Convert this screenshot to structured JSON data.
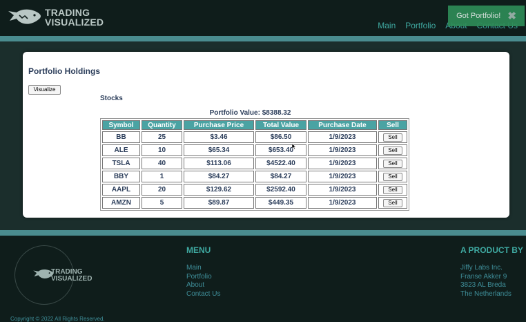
{
  "header": {
    "logo_line1": "TRADING",
    "logo_line2": "VISUALIZED",
    "nav": [
      "Main",
      "Portfolio",
      "About",
      "Contact Us"
    ],
    "notice": "Got Portfolio!",
    "notice_close": "✖"
  },
  "main": {
    "title": "Portfolio Holdings",
    "visualize_label": "Visualize",
    "section_title": "Stocks",
    "portfolio_value": "Portfolio Value: $8388.32",
    "columns": [
      "Symbol",
      "Quantity",
      "Purchase Price",
      "Total Value",
      "Purchase Date",
      "Sell"
    ],
    "rows": [
      {
        "symbol": "BB",
        "quantity": "25",
        "purchase_price": "$3.46",
        "total_value": "$86.50",
        "purchase_date": "1/9/2023",
        "sell": "Sell"
      },
      {
        "symbol": "ALE",
        "quantity": "10",
        "purchase_price": "$65.34",
        "total_value": "$653.40",
        "purchase_date": "1/9/2023",
        "sell": "Sell"
      },
      {
        "symbol": "TSLA",
        "quantity": "40",
        "purchase_price": "$113.06",
        "total_value": "$4522.40",
        "purchase_date": "1/9/2023",
        "sell": "Sell"
      },
      {
        "symbol": "BBY",
        "quantity": "1",
        "purchase_price": "$84.27",
        "total_value": "$84.27",
        "purchase_date": "1/9/2023",
        "sell": "Sell"
      },
      {
        "symbol": "AAPL",
        "quantity": "20",
        "purchase_price": "$129.62",
        "total_value": "$2592.40",
        "purchase_date": "1/9/2023",
        "sell": "Sell"
      },
      {
        "symbol": "AMZN",
        "quantity": "5",
        "purchase_price": "$89.87",
        "total_value": "$449.35",
        "purchase_date": "1/9/2023",
        "sell": "Sell"
      }
    ]
  },
  "footer": {
    "logo_line1": "TRADING",
    "logo_line2": "VISUALIZED",
    "menu_heading": "MENU",
    "menu_links": [
      "Main",
      "Portfolio",
      "About",
      "Contact Us"
    ],
    "product_heading": "A PRODUCT BY",
    "address": [
      "Jiffy Labs Inc.",
      "Franse Akker 9",
      "3823 AL Breda",
      "The Netherlands"
    ],
    "copyright": "Copyright © 2022 All Rights Reserved."
  },
  "colors": {
    "background": "#0f1d1b",
    "accent": "#4aa3a3",
    "link": "#3fa9a1",
    "notice": "#2e8b57"
  },
  "icons": {
    "logo": "fish-icon",
    "notice_close": "close-icon",
    "cursor": "pointer-cursor-icon"
  }
}
